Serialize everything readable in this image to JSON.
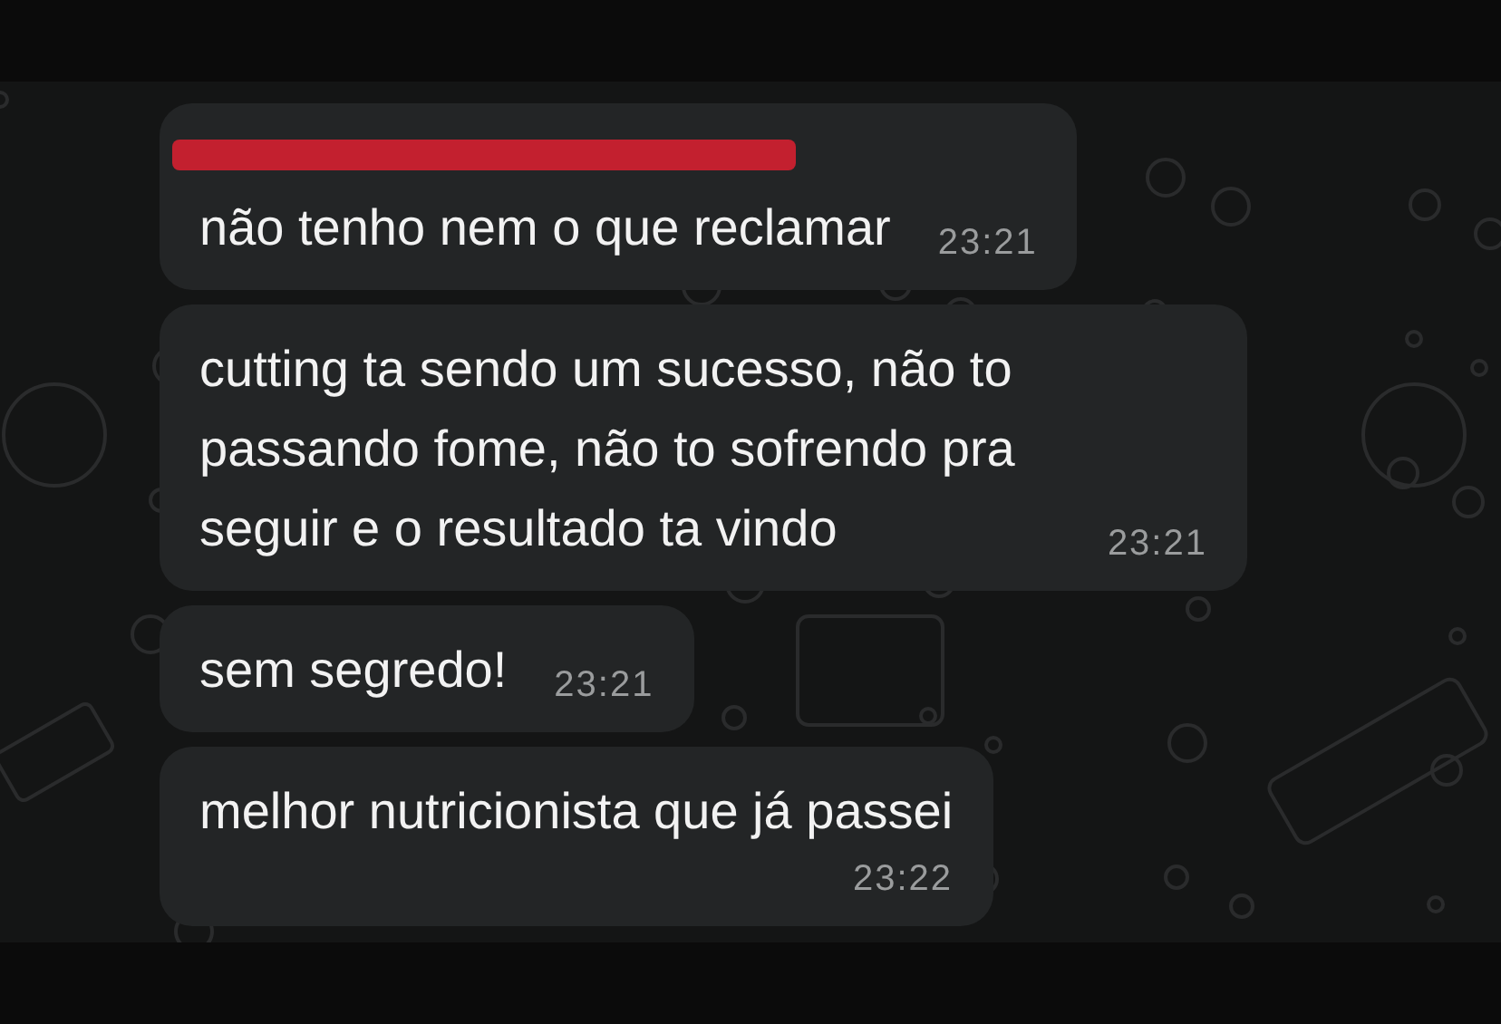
{
  "messages": [
    {
      "kind": "inline",
      "redacted_sender": true,
      "text": "não tenho nem o que reclamar",
      "time": "23:21"
    },
    {
      "kind": "inline",
      "text": "cutting ta sendo um sucesso, não to passando fome, não to sofrendo pra seguir e o resultado ta vindo",
      "time": "23:21"
    },
    {
      "kind": "inline",
      "text": "sem segredo!",
      "time": "23:21"
    },
    {
      "kind": "stacked",
      "text": "melhor nutricionista que já passei",
      "time": "23:22"
    }
  ]
}
